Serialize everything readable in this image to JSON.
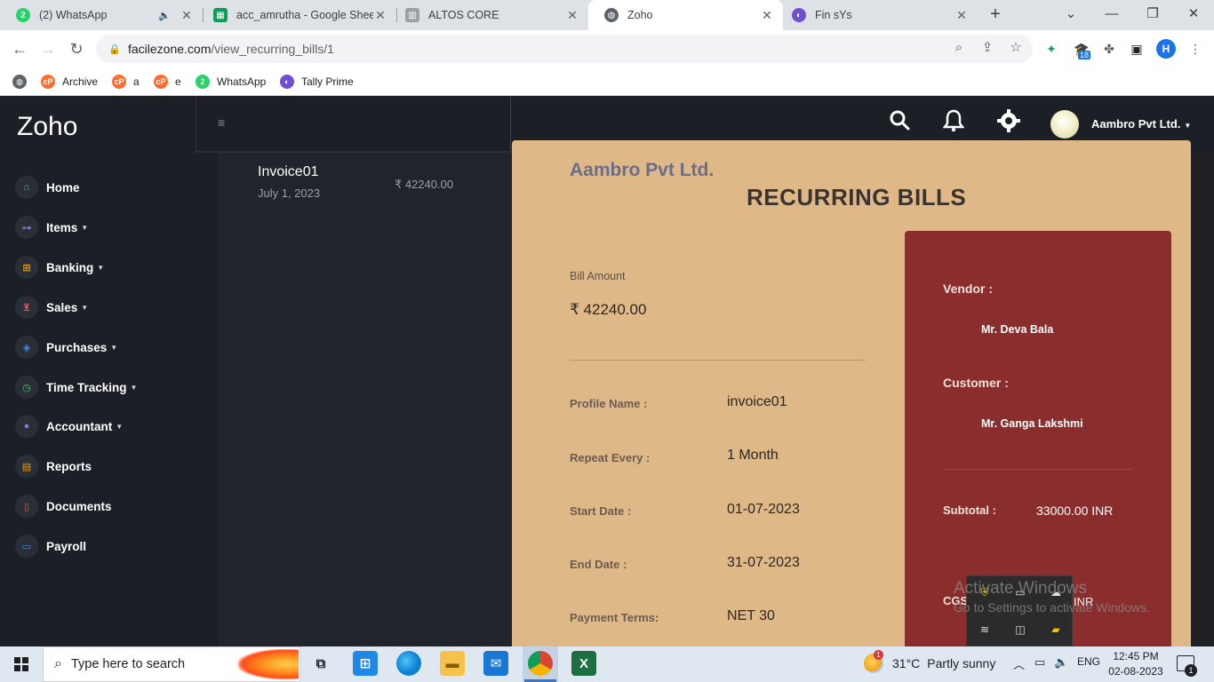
{
  "browser": {
    "tabs": [
      {
        "title": "(2) WhatsApp",
        "favicon": "whatsapp-icon",
        "favicon_text": "2",
        "color": "#25d366"
      },
      {
        "title": "acc_amrutha - Google Sheets",
        "favicon": "sheets-icon",
        "color": "#0f9d58"
      },
      {
        "title": "ALTOS CORE",
        "favicon": "page-icon",
        "color": "#9aa0a6"
      },
      {
        "title": "Zoho",
        "favicon": "globe-icon",
        "color": "#5f6368",
        "active": true
      },
      {
        "title": "Fin sYs",
        "favicon": "tally-icon",
        "color": "#6f4fcf"
      }
    ],
    "address": {
      "host": "facilezone.com",
      "path": "/view_recurring_bills/1"
    },
    "extension_badge": "18",
    "profile_initial": "H",
    "bookmarks": [
      {
        "label": "Archive",
        "icon": "cpanel-icon",
        "color": "#ff6c2c"
      },
      {
        "label": "a",
        "icon": "cpanel-icon",
        "color": "#ff6c2c"
      },
      {
        "label": "e",
        "icon": "cpanel-icon",
        "color": "#ff6c2c"
      },
      {
        "label": "WhatsApp",
        "icon": "whatsapp-icon",
        "color": "#25d366",
        "icon_text": "2"
      },
      {
        "label": "Tally Prime",
        "icon": "tally-icon",
        "color": "#6f4fcf"
      }
    ]
  },
  "app": {
    "brand": "Zoho",
    "org_name": "Aambro Pvt Ltd.",
    "nav": [
      {
        "label": "Home",
        "icon": "home-icon",
        "color": "#2ecc71",
        "dropdown": false
      },
      {
        "label": "Items",
        "icon": "hierarchy-icon",
        "color": "#8e6fd6",
        "dropdown": true
      },
      {
        "label": "Banking",
        "icon": "bank-icon",
        "color": "#f1a10b",
        "dropdown": true
      },
      {
        "label": "Sales",
        "icon": "cart-icon",
        "color": "#e05353",
        "dropdown": true
      },
      {
        "label": "Purchases",
        "icon": "basket-icon",
        "color": "#3a8de0",
        "dropdown": true
      },
      {
        "label": "Time Tracking",
        "icon": "clock-icon",
        "color": "#2ecc71",
        "dropdown": true
      },
      {
        "label": "Accountant",
        "icon": "person-icon",
        "color": "#8e6fd6",
        "dropdown": true
      },
      {
        "label": "Reports",
        "icon": "report-icon",
        "color": "#f1a10b",
        "dropdown": false
      },
      {
        "label": "Documents",
        "icon": "document-icon",
        "color": "#e05353",
        "dropdown": false
      },
      {
        "label": "Payroll",
        "icon": "payroll-icon",
        "color": "#3a8de0",
        "dropdown": false
      }
    ],
    "bill_list": [
      {
        "name": "Invoice01",
        "date": "July 1, 2023",
        "amount": "₹ 42240.00"
      }
    ],
    "bill": {
      "company": "Aambro Pvt Ltd.",
      "page_title": "RECURRING BILLS",
      "amount_label": "Bill Amount",
      "amount_value": "₹ 42240.00",
      "fields": [
        {
          "label": "Profile Name :",
          "value": "invoice01"
        },
        {
          "label": "Repeat Every :",
          "value": "1 Month"
        },
        {
          "label": "Start Date :",
          "value": "01-07-2023"
        },
        {
          "label": "End Date :",
          "value": "31-07-2023"
        },
        {
          "label": "Payment Terms:",
          "value": "NET 30"
        }
      ],
      "vendor_label": "Vendor :",
      "vendor_value": "Mr. Deva Bala",
      "customer_label": "Customer :",
      "customer_value": "Mr. Ganga Lakshmi",
      "subtotal_label": "Subtotal :",
      "subtotal_value": "33000.00 INR",
      "cgst_label": "CGS",
      "cgst_value": "INR"
    }
  },
  "overlay": {
    "watermark_title": "Activate Windows",
    "watermark_sub": "Go to Settings to activate Windows."
  },
  "taskbar": {
    "search_placeholder": "Type here to search",
    "apps": [
      "task-view-icon",
      "store-icon",
      "edge-icon",
      "file-explorer-icon",
      "mail-icon",
      "chrome-icon",
      "excel-icon"
    ],
    "weather": {
      "temp": "31°C",
      "condition": "Partly sunny",
      "badge": "1"
    },
    "language": "ENG",
    "time": "12:45 PM",
    "date": "02-08-2023",
    "notifications": "1"
  }
}
